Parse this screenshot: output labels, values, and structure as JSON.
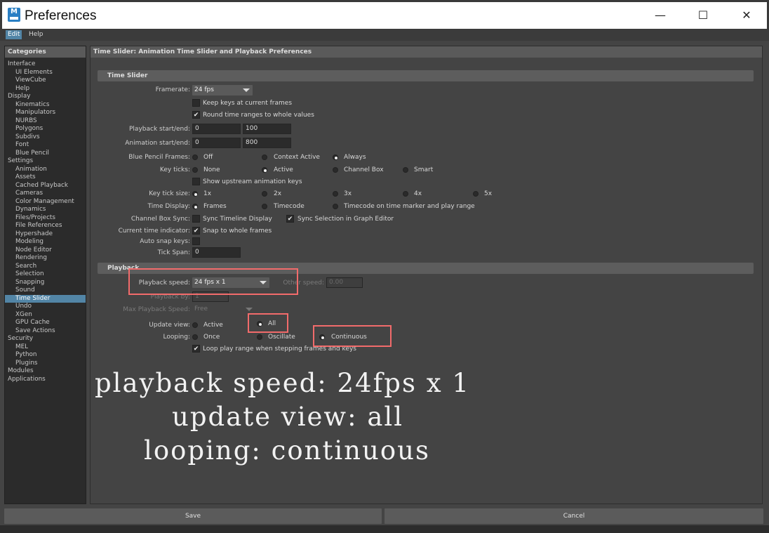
{
  "window": {
    "title": "Preferences",
    "app_icon_letter": "M",
    "controls": {
      "minimize": "—",
      "maximize": "☐",
      "close": "✕"
    }
  },
  "menubar": {
    "items": [
      "Edit",
      "Help"
    ]
  },
  "categories": {
    "header": "Categories",
    "items": [
      {
        "label": "Interface",
        "level": 0
      },
      {
        "label": "UI Elements",
        "level": 1
      },
      {
        "label": "ViewCube",
        "level": 1
      },
      {
        "label": "Help",
        "level": 1
      },
      {
        "label": "Display",
        "level": 0
      },
      {
        "label": "Kinematics",
        "level": 1
      },
      {
        "label": "Manipulators",
        "level": 1
      },
      {
        "label": "NURBS",
        "level": 1
      },
      {
        "label": "Polygons",
        "level": 1
      },
      {
        "label": "Subdivs",
        "level": 1
      },
      {
        "label": "Font",
        "level": 1
      },
      {
        "label": "Blue Pencil",
        "level": 1
      },
      {
        "label": "Settings",
        "level": 0
      },
      {
        "label": "Animation",
        "level": 1
      },
      {
        "label": "Assets",
        "level": 1
      },
      {
        "label": "Cached Playback",
        "level": 1
      },
      {
        "label": "Cameras",
        "level": 1
      },
      {
        "label": "Color Management",
        "level": 1
      },
      {
        "label": "Dynamics",
        "level": 1
      },
      {
        "label": "Files/Projects",
        "level": 1
      },
      {
        "label": "File References",
        "level": 1
      },
      {
        "label": "Hypershade",
        "level": 1
      },
      {
        "label": "Modeling",
        "level": 1
      },
      {
        "label": "Node Editor",
        "level": 1
      },
      {
        "label": "Rendering",
        "level": 1
      },
      {
        "label": "Search",
        "level": 1
      },
      {
        "label": "Selection",
        "level": 1
      },
      {
        "label": "Snapping",
        "level": 1
      },
      {
        "label": "Sound",
        "level": 1
      },
      {
        "label": "Time Slider",
        "level": 1,
        "selected": true
      },
      {
        "label": "Undo",
        "level": 1
      },
      {
        "label": "XGen",
        "level": 1
      },
      {
        "label": "GPU Cache",
        "level": 1
      },
      {
        "label": "Save Actions",
        "level": 1
      },
      {
        "label": "Security",
        "level": 0
      },
      {
        "label": "MEL",
        "level": 1
      },
      {
        "label": "Python",
        "level": 1
      },
      {
        "label": "Plugins",
        "level": 1
      },
      {
        "label": "Modules",
        "level": 0
      },
      {
        "label": "Applications",
        "level": 0
      }
    ]
  },
  "main": {
    "header": "Time Slider: Animation Time Slider and Playback Preferences",
    "time_slider": {
      "section_title": "Time Slider",
      "framerate_label": "Framerate:",
      "framerate_value": "24 fps",
      "keep_keys_label": "Keep keys at current frames",
      "keep_keys_checked": false,
      "round_time_label": "Round time ranges to whole values",
      "round_time_checked": true,
      "playback_startend_label": "Playback start/end:",
      "playback_start": "0",
      "playback_end": "100",
      "animation_startend_label": "Animation start/end:",
      "animation_start": "0",
      "animation_end": "800",
      "blue_pencil_label": "Blue Pencil Frames:",
      "blue_pencil_options": [
        "Off",
        "Context Active",
        "Always"
      ],
      "blue_pencil_selected": "Always",
      "key_ticks_label": "Key ticks:",
      "key_ticks_options": [
        "None",
        "Active",
        "Channel Box",
        "Smart"
      ],
      "key_ticks_selected": "Active",
      "show_upstream_label": "Show upstream animation keys",
      "show_upstream_checked": false,
      "key_tick_size_label": "Key tick size:",
      "key_tick_size_options": [
        "1x",
        "2x",
        "3x",
        "4x",
        "5x"
      ],
      "key_tick_size_selected": "1x",
      "time_display_label": "Time Display:",
      "time_display_options": [
        "Frames",
        "Timecode",
        "Timecode on time marker and play range"
      ],
      "time_display_selected": "Frames",
      "channel_box_sync_label": "Channel Box Sync:",
      "sync_timeline_label": "Sync Timeline Display",
      "sync_timeline_checked": false,
      "sync_selection_label": "Sync Selection in Graph Editor",
      "sync_selection_checked": true,
      "current_time_indicator_label": "Current time indicator:",
      "snap_whole_frames_label": "Snap to whole frames",
      "snap_whole_frames_checked": true,
      "auto_snap_keys_label": "Auto snap keys:",
      "auto_snap_keys_checked": false,
      "tick_span_label": "Tick Span:",
      "tick_span_value": "0"
    },
    "playback": {
      "section_title": "Playback",
      "playback_speed_label": "Playback speed:",
      "playback_speed_value": "24 fps x 1",
      "other_speed_label": "Other speed:",
      "other_speed_value": "0.00",
      "playback_by_label": "Playback by:",
      "playback_by_value": "1",
      "max_playback_speed_label": "Max Playback Speed:",
      "max_playback_speed_value": "Free",
      "update_view_label": "Update view:",
      "update_view_options": [
        "Active",
        "All"
      ],
      "update_view_selected": "All",
      "looping_label": "Looping:",
      "looping_options": [
        "Once",
        "Oscillate",
        "Continuous"
      ],
      "looping_selected": "Continuous",
      "loop_play_range_label": "Loop play range when stepping frames and keys",
      "loop_play_range_checked": true
    }
  },
  "overlay": {
    "line1": "playback speed: 24fps x 1",
    "line2": "update view: all",
    "line3": "looping: continuous"
  },
  "footer": {
    "save_label": "Save",
    "cancel_label": "Cancel"
  },
  "colors": {
    "accent": "#5285a6",
    "highlight_box": "#f26b6b",
    "panel_bg": "#444444"
  }
}
